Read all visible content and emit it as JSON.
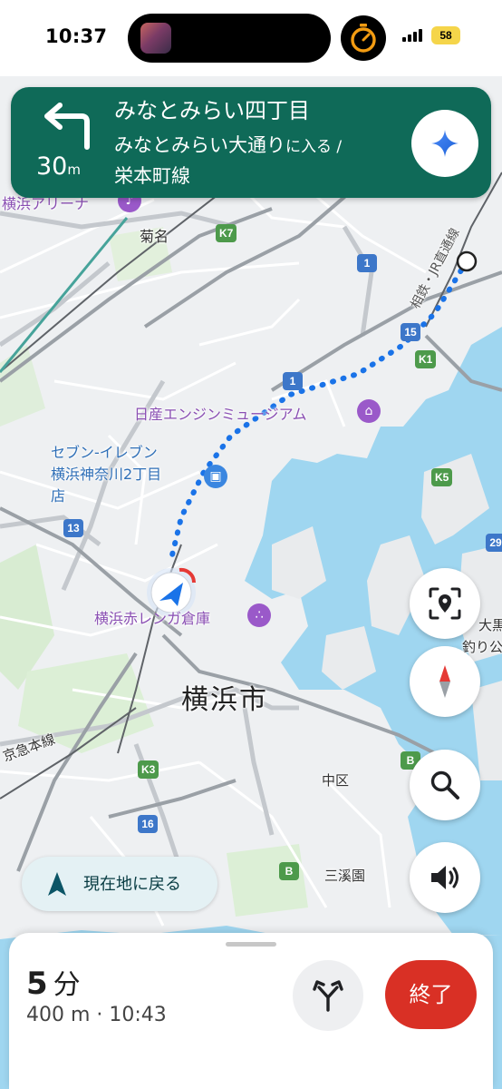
{
  "status_bar": {
    "time": "10:37",
    "battery": "58",
    "battery_color": "#f5d54a",
    "icons": [
      "dynamic-island",
      "timer-icon",
      "signal-icon",
      "battery-icon"
    ]
  },
  "navigation": {
    "turn_direction": "turn-left",
    "distance_value": "30",
    "distance_unit": "m",
    "street": "みなとみらい四丁目",
    "instruction_road": "みなとみらい大通り",
    "instruction_suffix": "に入る /",
    "instruction_line2": "栄本町線",
    "banner_color": "#0f6a58"
  },
  "map": {
    "route_color": "#1a73e8",
    "labels": {
      "arena": "横浜アリーナ",
      "kikuna": "菊名",
      "jr_line": "相鉄・JR直通線",
      "nissan": "日産エンジンミュージアム",
      "seven_line1": "セブン-イレブン",
      "seven_line2": "横浜神奈川2丁目",
      "seven_line3": "店",
      "redbrick": "横浜赤レンガ倉庫",
      "city": "横浜市",
      "naka": "中区",
      "sankeien": "三溪園",
      "keikyu": "京急本線",
      "daikoku1": "大黒",
      "daikoku2": "釣り公"
    },
    "shields": {
      "k7": "K7",
      "k1": "K1",
      "k5": "K5",
      "k3": "K3",
      "r1a": "1",
      "r1b": "1",
      "r15": "15",
      "r13": "13",
      "r16": "16",
      "b1": "B",
      "b2": "B",
      "r29": "29"
    }
  },
  "controls": {
    "recenter_label": "現在地に戻る",
    "buttons": [
      "report-location-icon",
      "compass-icon",
      "search-icon",
      "sound-icon"
    ]
  },
  "trip": {
    "minutes": "5",
    "minutes_unit": "分",
    "details": "400 m · 10:43",
    "end_label": "終了",
    "end_color": "#d93025"
  }
}
